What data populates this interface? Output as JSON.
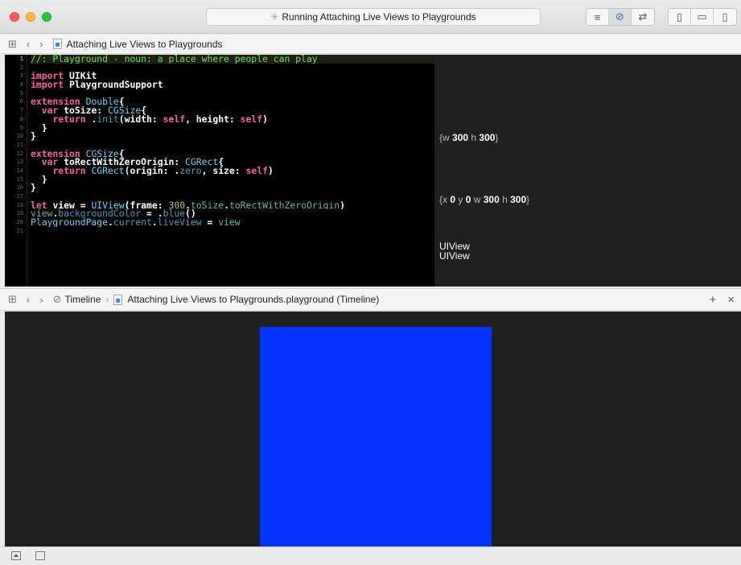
{
  "window": {
    "activity_text": "Running Attaching Live Views to Playgrounds"
  },
  "jumpbar": {
    "filename": "Attaching Live Views to Playgrounds"
  },
  "editor": {
    "line_numbers": [
      "1",
      "2",
      "3",
      "4",
      "5",
      "6",
      "7",
      "8",
      "9",
      "10",
      "11",
      "12",
      "13",
      "14",
      "15",
      "16",
      "17",
      "18",
      "19",
      "20",
      "21"
    ]
  },
  "results": [
    {
      "label": "{w 300 h 300}"
    },
    {
      "label": "{x 0 y 0 w 300 h 300}"
    },
    {
      "label": "UIView"
    },
    {
      "label": "UIView"
    }
  ],
  "timeline": {
    "label": "Timeline",
    "filename": "Attaching Live Views to Playgrounds.playground (Timeline)"
  },
  "live_view": {
    "background_color": "#0433ff"
  }
}
